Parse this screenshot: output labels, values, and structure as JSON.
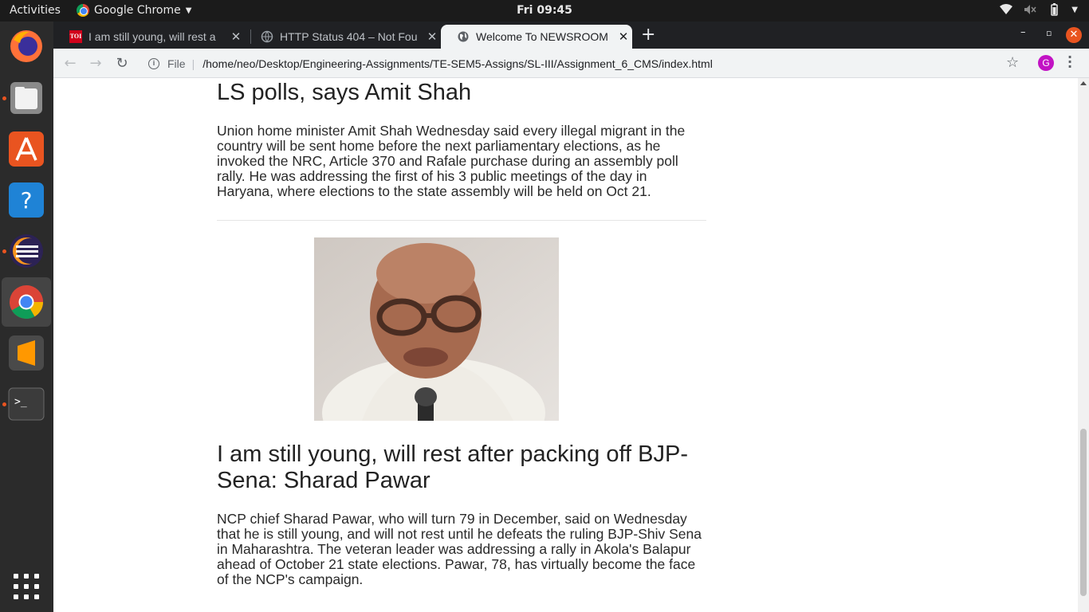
{
  "topbar": {
    "activities": "Activities",
    "app_name": "Google Chrome",
    "clock": "Fri 09:45"
  },
  "dock": {
    "items": [
      "firefox-icon",
      "files-icon",
      "software-center-icon",
      "help-icon",
      "eclipse-icon",
      "chrome-icon",
      "sublime-text-icon",
      "terminal-icon"
    ]
  },
  "browser": {
    "tabs": [
      {
        "title": "I am still young, will rest a",
        "favicon": "TOI"
      },
      {
        "title": "HTTP Status 404 – Not Fou"
      },
      {
        "title": "Welcome To NEWSROOM"
      }
    ],
    "address": {
      "scheme": "File",
      "url": "/home/neo/Desktop/Engineering-Assignments/TE-SEM5-Assigns/SL-III/Assignment_6_CMS/index.html"
    },
    "profile_initial": "G"
  },
  "articles": [
    {
      "headline": "LS polls, says Amit Shah",
      "body": "Union home minister Amit Shah Wednesday said every illegal migrant in the country will be sent home before the next parliamentary elections, as he invoked the NRC, Article 370 and Rafale purchase during an assembly poll rally. He was addressing the first of his 3 public meetings of the day in Haryana, where elections to the state assembly will be held on Oct 21."
    },
    {
      "headline": "I am still young, will rest after packing off BJP-Sena: Sharad Pawar",
      "body": "NCP chief Sharad Pawar, who will turn 79 in December, said on Wednesday that he is still young, and will not rest until he defeats the ruling BJP-Shiv Sena in Maharashtra. The veteran leader was addressing a rally in Akola's Balapur ahead of October 21 state elections. Pawar, 78, has virtually become the face of the NCP's campaign."
    }
  ],
  "colors": {
    "topbar": "#1b1b1b",
    "dock": "#2b2b2b",
    "accent": "#e95420",
    "tabstrip": "#202124",
    "toolbar": "#f1f3f4"
  }
}
